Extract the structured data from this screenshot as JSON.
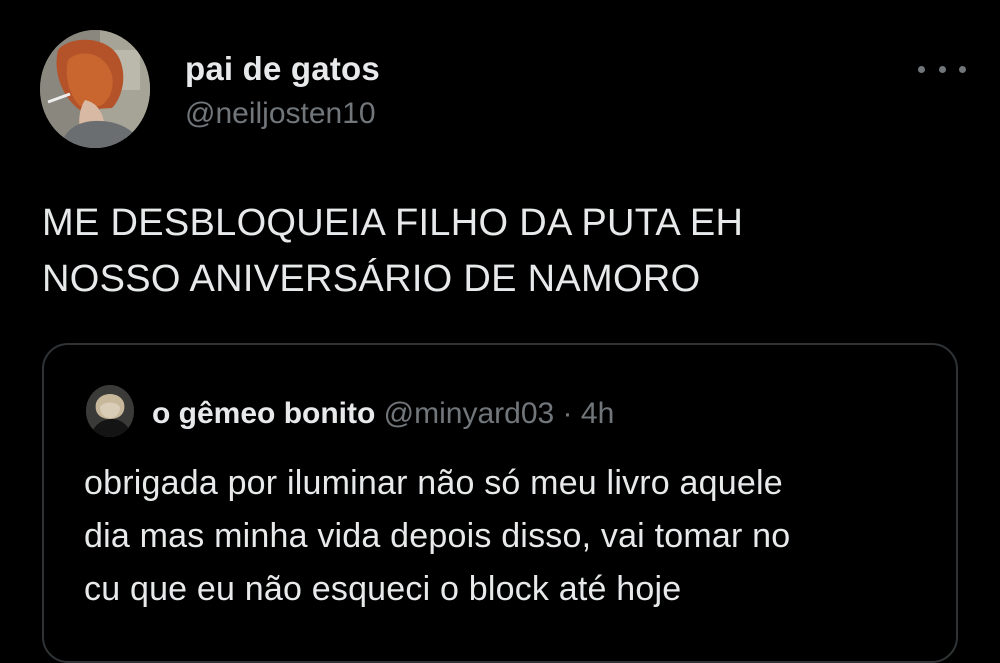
{
  "theme": {
    "background": "#000000",
    "text_primary": "#e7e9ea",
    "text_secondary": "#71767b",
    "border": "#2f3336"
  },
  "tweet": {
    "author": {
      "display_name": "pai de gatos",
      "handle": "@neiljosten10",
      "avatar_icon": "profile-photo-red-hair"
    },
    "more_icon": "more-options-icon",
    "text_lines": [
      "ME DESBLOQUEIA FILHO DA PUTA EH",
      "NOSSO ANIVERSÁRIO DE NAMORO"
    ]
  },
  "quoted_tweet": {
    "author": {
      "display_name": "o gêmeo bonito",
      "handle": "@minyard03",
      "avatar_icon": "profile-photo-dark"
    },
    "separator": "·",
    "time": "4h",
    "text_lines": [
      "obrigada por iluminar não só meu livro aquele",
      "dia mas minha vida depois disso, vai tomar no",
      "cu que eu não esqueci o block até hoje"
    ]
  }
}
